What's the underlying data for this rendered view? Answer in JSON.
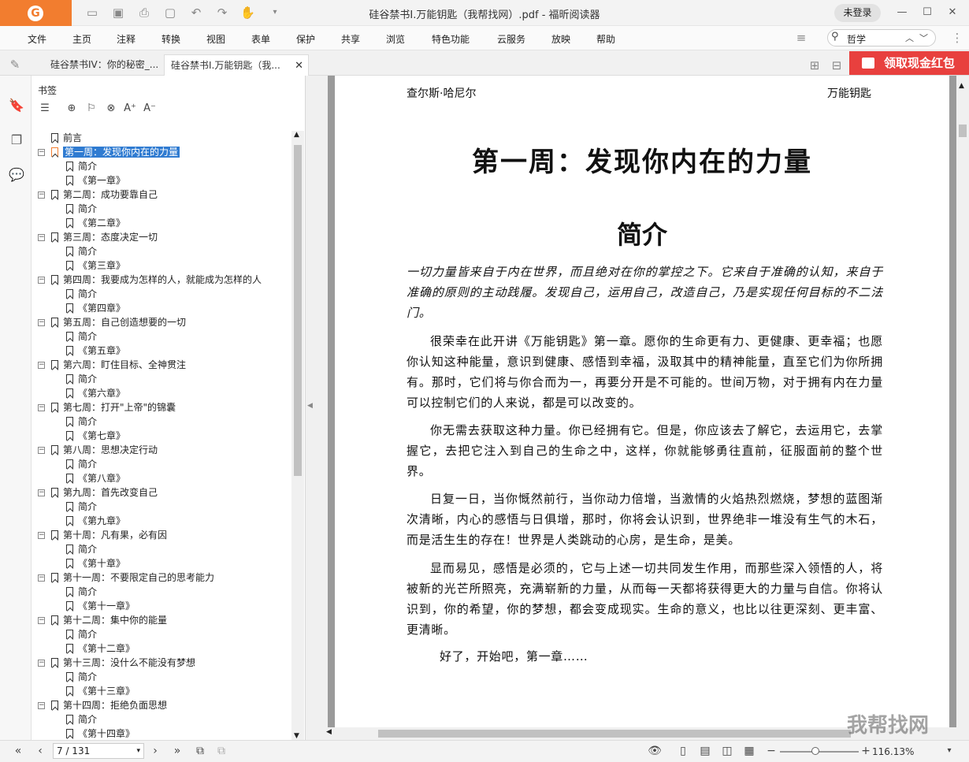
{
  "window": {
    "title": "硅谷禁书I.万能钥匙（我帮找网）.pdf - 福昕阅读器",
    "login_label": "未登录"
  },
  "menu": [
    "文件",
    "主页",
    "注释",
    "转换",
    "视图",
    "表单",
    "保护",
    "共享",
    "浏览",
    "特色功能",
    "云服务",
    "放映",
    "帮助"
  ],
  "search": {
    "value": "哲学"
  },
  "tabs": [
    {
      "label": "硅谷禁书IV：你的秘密_..."
    },
    {
      "label": "硅谷禁书I.万能钥匙（我..."
    }
  ],
  "promo_label": "领取现金红包",
  "panel": {
    "title": "书签"
  },
  "bookmarks": [
    {
      "label": "前言",
      "level": 0,
      "expand": false
    },
    {
      "label": "第一周：发现你内在的力量",
      "level": 0,
      "expand": true,
      "selected": true
    },
    {
      "label": "简介",
      "level": 1
    },
    {
      "label": "《第一章》",
      "level": 1
    },
    {
      "label": "第二周：成功要靠自己",
      "level": 0,
      "expand": true
    },
    {
      "label": "简介",
      "level": 1
    },
    {
      "label": "《第二章》",
      "level": 1
    },
    {
      "label": "第三周：态度决定一切",
      "level": 0,
      "expand": true
    },
    {
      "label": "简介",
      "level": 1
    },
    {
      "label": "《第三章》",
      "level": 1
    },
    {
      "label": "第四周：我要成为怎样的人，就能成为怎样的人",
      "level": 0,
      "expand": true
    },
    {
      "label": "简介",
      "level": 1
    },
    {
      "label": "《第四章》",
      "level": 1
    },
    {
      "label": "第五周：自己创造想要的一切",
      "level": 0,
      "expand": true
    },
    {
      "label": "简介",
      "level": 1
    },
    {
      "label": "《第五章》",
      "level": 1
    },
    {
      "label": "第六周：盯住目标、全神贯注",
      "level": 0,
      "expand": true
    },
    {
      "label": "简介",
      "level": 1
    },
    {
      "label": "《第六章》",
      "level": 1
    },
    {
      "label": "第七周：打开\"上帝\"的锦囊",
      "level": 0,
      "expand": true
    },
    {
      "label": "简介",
      "level": 1
    },
    {
      "label": "《第七章》",
      "level": 1
    },
    {
      "label": "第八周：思想决定行动",
      "level": 0,
      "expand": true
    },
    {
      "label": "简介",
      "level": 1
    },
    {
      "label": "《第八章》",
      "level": 1
    },
    {
      "label": "第九周：首先改变自己",
      "level": 0,
      "expand": true
    },
    {
      "label": "简介",
      "level": 1
    },
    {
      "label": "《第九章》",
      "level": 1
    },
    {
      "label": "第十周：凡有果，必有因",
      "level": 0,
      "expand": true
    },
    {
      "label": "简介",
      "level": 1
    },
    {
      "label": "《第十章》",
      "level": 1
    },
    {
      "label": "第十一周：不要限定自己的思考能力",
      "level": 0,
      "expand": true
    },
    {
      "label": "简介",
      "level": 1
    },
    {
      "label": "《第十一章》",
      "level": 1
    },
    {
      "label": "第十二周：集中你的能量",
      "level": 0,
      "expand": true
    },
    {
      "label": "简介",
      "level": 1
    },
    {
      "label": "《第十二章》",
      "level": 1
    },
    {
      "label": "第十三周：没什么不能没有梦想",
      "level": 0,
      "expand": true
    },
    {
      "label": "简介",
      "level": 1
    },
    {
      "label": "《第十三章》",
      "level": 1
    },
    {
      "label": "第十四周：拒绝负面思想",
      "level": 0,
      "expand": true
    },
    {
      "label": "简介",
      "level": 1
    },
    {
      "label": "《第十四章》",
      "level": 1
    }
  ],
  "page": {
    "header_left": "查尔斯·哈尼尔",
    "header_right": "万能钥匙",
    "chapter_title": "第一周：发现你内在的力量",
    "section_title": "简介",
    "paragraphs": [
      "一切力量皆来自于内在世界，而且绝对在你的掌控之下。它来自于准确的认知，来自于准确的原则的主动践履。发现自己，运用自己，改造自己，乃是实现任何目标的不二法门。",
      "很荣幸在此开讲《万能钥匙》第一章。愿你的生命更有力、更健康、更幸福；也愿你认知这种能量，意识到健康、感悟到幸福，汲取其中的精神能量，直至它们为你所拥有。那时，它们将与你合而为一，再要分开是不可能的。世间万物，对于拥有内在力量可以控制它们的人来说，都是可以改变的。",
      "你无需去获取这种力量。你已经拥有它。但是，你应该去了解它，去运用它，去掌握它，去把它注入到自己的生命之中，这样，你就能够勇往直前，征服面前的整个世界。",
      "日复一日，当你慨然前行，当你动力倍增，当激情的火焰热烈燃烧，梦想的蓝图渐次清晰，内心的感悟与日俱增，那时，你将会认识到，世界绝非一堆没有生气的木石，而是活生生的存在！世界是人类跳动的心房，是生命，是美。",
      "显而易见，感悟是必须的，它与上述一切共同发生作用，而那些深入领悟的人，将被新的光芒所照亮，充满崭新的力量，从而每一天都将获得更大的力量与自信。你将认识到，你的希望，你的梦想，都会变成现实。生命的意义，也比以往更深刻、更丰富、更清晰。",
      "好了，开始吧，第一章……"
    ]
  },
  "status": {
    "page_indicator": "7 / 131",
    "zoom": "116.13%"
  },
  "watermark": "我帮找网"
}
